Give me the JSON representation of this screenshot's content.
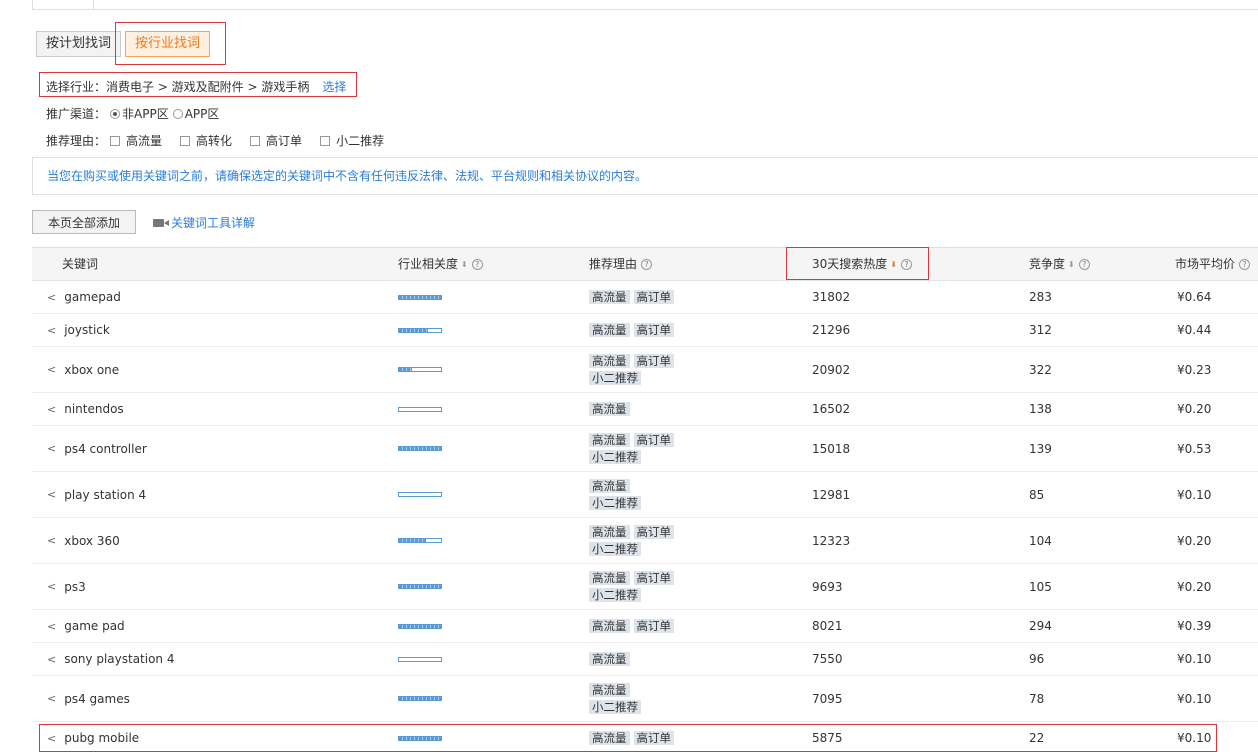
{
  "mode_tabs": {
    "by_plan": "按计划找词",
    "by_industry": "按行业找词"
  },
  "industry": {
    "label": "选择行业：消费电子 > 游戏及配附件 > 游戏手柄",
    "select_link": "选择"
  },
  "channel": {
    "label": "推广渠道：",
    "options": [
      {
        "label": "非APP区",
        "selected": true
      },
      {
        "label": "APP区",
        "selected": false
      }
    ]
  },
  "reasons": {
    "label": "推荐理由：",
    "options": [
      "高流量",
      "高转化",
      "高订单",
      "小二推荐"
    ]
  },
  "notice": "当您在购买或使用关键词之前，请确保选定的关键词中不含有任何违反法律、法规、平台规则和相关协议的内容。",
  "add_all_button": "本页全部添加",
  "tool_link": "关键词工具详解",
  "table": {
    "headers": {
      "keyword": "关键词",
      "relevance": "行业相关度",
      "reason": "推荐理由",
      "heat": "30天搜索热度",
      "competition": "竞争度",
      "price": "市场平均价"
    },
    "rows": [
      {
        "keyword": "gamepad",
        "relevance": 1.0,
        "tags": [
          "高流量",
          "高订单"
        ],
        "heat": "31802",
        "competition": "283",
        "price": "¥0.64"
      },
      {
        "keyword": "joystick",
        "relevance": 0.7,
        "tags": [
          "高流量",
          "高订单"
        ],
        "heat": "21296",
        "competition": "312",
        "price": "¥0.44"
      },
      {
        "keyword": "xbox one",
        "relevance": 0.3,
        "tags": [
          "高流量",
          "高订单",
          "小二推荐"
        ],
        "heat": "20902",
        "competition": "322",
        "price": "¥0.23"
      },
      {
        "keyword": "nintendos",
        "relevance": 0.0,
        "tags": [
          "高流量"
        ],
        "heat": "16502",
        "competition": "138",
        "price": "¥0.20"
      },
      {
        "keyword": "ps4 controller",
        "relevance": 1.0,
        "tags": [
          "高流量",
          "高订单",
          "小二推荐"
        ],
        "heat": "15018",
        "competition": "139",
        "price": "¥0.53"
      },
      {
        "keyword": "play station 4",
        "relevance": 0.0,
        "tags": [
          "高流量",
          "小二推荐"
        ],
        "heat": "12981",
        "competition": "85",
        "price": "¥0.10"
      },
      {
        "keyword": "xbox 360",
        "relevance": 0.65,
        "tags": [
          "高流量",
          "高订单",
          "小二推荐"
        ],
        "heat": "12323",
        "competition": "104",
        "price": "¥0.20"
      },
      {
        "keyword": "ps3",
        "relevance": 1.0,
        "tags": [
          "高流量",
          "高订单",
          "小二推荐"
        ],
        "heat": "9693",
        "competition": "105",
        "price": "¥0.20"
      },
      {
        "keyword": "game pad",
        "relevance": 1.0,
        "tags": [
          "高流量",
          "高订单"
        ],
        "heat": "8021",
        "competition": "294",
        "price": "¥0.39"
      },
      {
        "keyword": "sony playstation 4",
        "relevance": 0.0,
        "tags": [
          "高流量"
        ],
        "heat": "7550",
        "competition": "96",
        "price": "¥0.10"
      },
      {
        "keyword": "ps4 games",
        "relevance": 1.0,
        "tags": [
          "高流量",
          "小二推荐"
        ],
        "heat": "7095",
        "competition": "78",
        "price": "¥0.10"
      },
      {
        "keyword": "pubg mobile",
        "relevance": 1.0,
        "tags": [
          "高流量",
          "高订单"
        ],
        "heat": "5875",
        "competition": "22",
        "price": "¥0.10"
      }
    ]
  },
  "colors": {
    "accent_orange": "#f07a1a",
    "link_blue": "#2b7cd9",
    "highlight_red": "#d9363e"
  }
}
